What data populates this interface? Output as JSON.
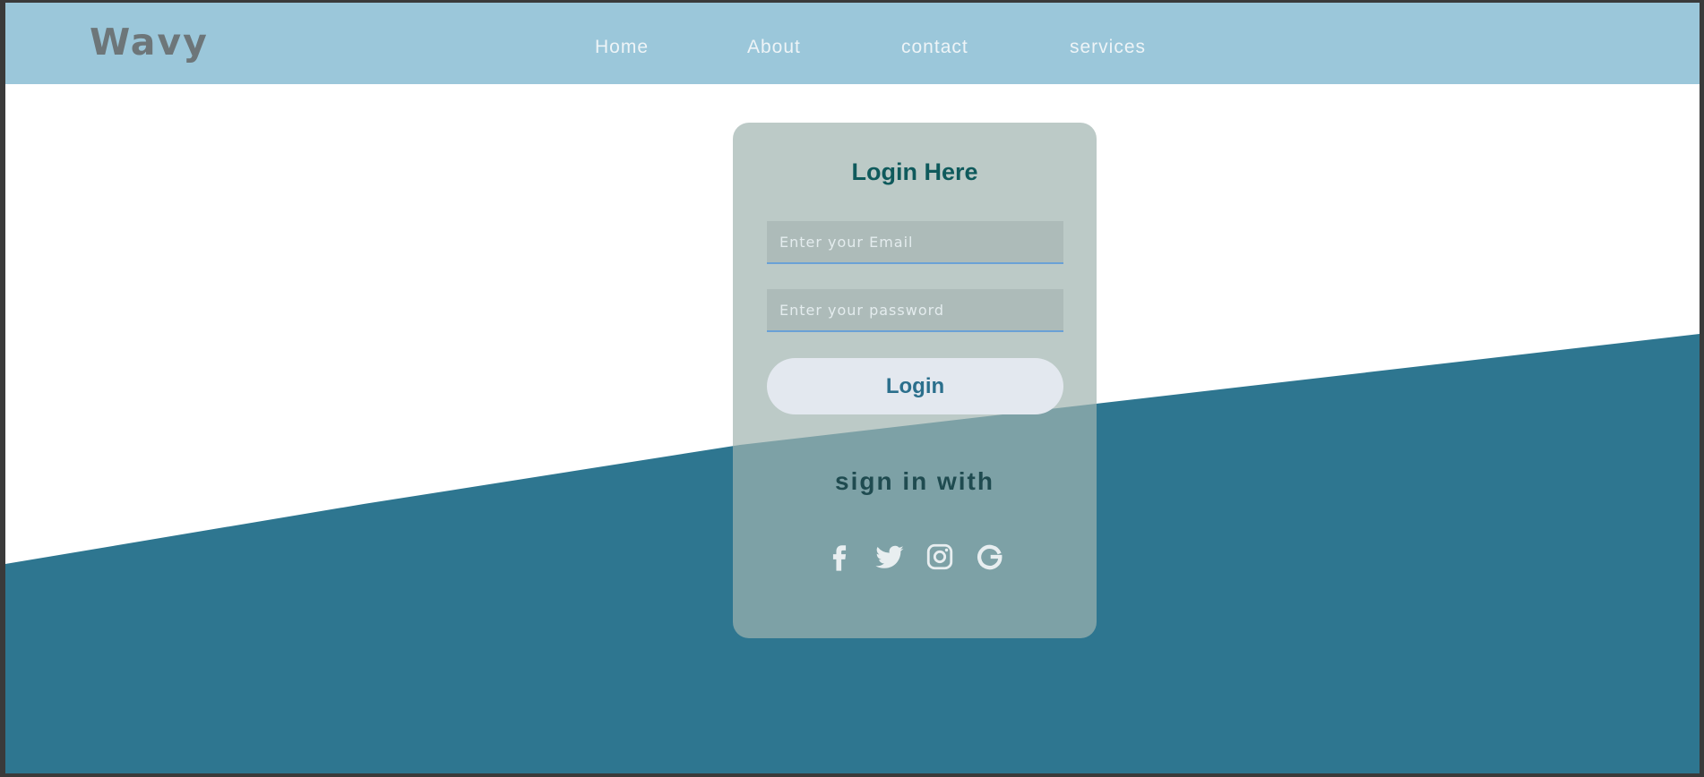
{
  "nav": {
    "logo": "Wavy",
    "links": [
      {
        "label": "Home"
      },
      {
        "label": "About"
      },
      {
        "label": "contact"
      },
      {
        "label": "services"
      }
    ]
  },
  "login": {
    "title": "Login Here",
    "email_placeholder": "Enter your Email",
    "password_placeholder": "Enter your password",
    "button_label": "Login",
    "signin_text": "sign in with",
    "socials": [
      "facebook-icon",
      "twitter-icon",
      "instagram-icon",
      "google-icon"
    ]
  },
  "colors": {
    "navbar": "#9bc7da",
    "wave": "#2e7690",
    "accent": "#2b6f8c",
    "title": "#0f5a5c"
  }
}
